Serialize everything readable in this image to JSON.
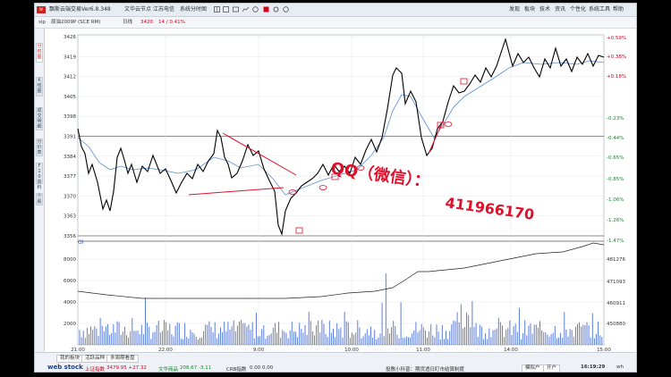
{
  "app": {
    "title_left": "飘斯云端交易",
    "version": "Ver6.8.348",
    "title_items": [
      "文华云节点",
      "江苏电信",
      "系统分时图"
    ],
    "menu": [
      "发现",
      "板块",
      "技术",
      "资讯",
      "个性化",
      "系统工具",
      "帮助"
    ]
  },
  "toolbar": {
    "symbol": "sip",
    "name": "原油2009P",
    "exchange": "(SCE RM)",
    "period": "日线",
    "price": "3420",
    "change": "14 / 0.41%"
  },
  "sidebar": {
    "tabs": [
      "分时图",
      "K线图",
      "成交明细",
      "分价表",
      "F10资料",
      "个股"
    ]
  },
  "price_axis": [
    "3426",
    "3419",
    "3412",
    "3405",
    "3398",
    "3391",
    "3384",
    "3377",
    "3370",
    "3363",
    "3356"
  ],
  "pct_axis": [
    "+0.59%",
    "+0.38%",
    "+0.18%",
    "-0.23%",
    "-0.44%",
    "-0.65%",
    "-0.85%",
    "-1.06%",
    "-1.26%",
    "-1.47%"
  ],
  "vol_axis": [
    "8000",
    "6000",
    "4000",
    "2000"
  ],
  "oi_axis": [
    "481276",
    "471093",
    "460911",
    "450880"
  ],
  "vol_label": "OI",
  "time_axis": [
    "21:00",
    "22:00",
    "9:00",
    "10:00",
    "11:00",
    "14:00",
    "15:00"
  ],
  "watermark": {
    "line1": "QQ（微信）：",
    "line2": "411966170"
  },
  "statusbar": {
    "tabs": [
      "我的板块",
      "活跃品种",
      "多周期看盘"
    ],
    "brand": "web stock",
    "idx1_name": "上证指数",
    "idx1_val": "3479.95 +27.32",
    "idx2_name": "文华商品",
    "idx2_val": "208.67 -3.11",
    "idx3_name": "CRB指数",
    "idx3_val": "0.00 0.00",
    "notice": "投教小科普：期货透日盯市结算制度",
    "btns": [
      "模拟户",
      "开户"
    ],
    "time": "16:19:29",
    "user": "wh"
  },
  "colors": {
    "accent": "#d0021b",
    "price_line": "#000000",
    "avg_line": "#5b8fd1",
    "volume": "#4a6fd6"
  }
}
